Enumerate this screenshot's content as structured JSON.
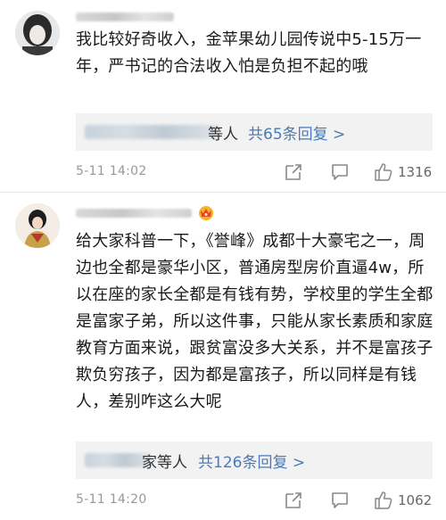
{
  "comments": [
    {
      "text": "我比较好奇收入，金苹果幼儿园传说中5-15万一年，严书记的合法收入怕是负担不起的哦",
      "reply_suffix": "等人",
      "reply_link": "共65条回复 >",
      "time": "5-11 14:02",
      "likes": "1316"
    },
    {
      "text": "给大家科普一下，《誉峰》成都十大豪宅之一，周边也全都是豪华小区，普通房型房价直逼4w，所以在座的家长全都是有钱有势，学校里的学生全都是富家子弟，所以这件事，只能从家长素质和家庭教育方面来说，跟贫富没多大关系，并不是富孩子欺负穷孩子，因为都是富孩子，所以同样是有钱人，差别咋这么大呢",
      "reply_suffix": "家等人",
      "reply_link": "共126条回复 >",
      "time": "5-11 14:20",
      "likes": "1062"
    }
  ],
  "icons": {
    "share": "share-icon",
    "comment": "comment-icon",
    "like": "thumbs-up-icon",
    "crown": "crown-badge-icon"
  },
  "colors": {
    "link": "#4a7bb8",
    "time": "#999999",
    "reply_bg": "#f2f2f2"
  }
}
